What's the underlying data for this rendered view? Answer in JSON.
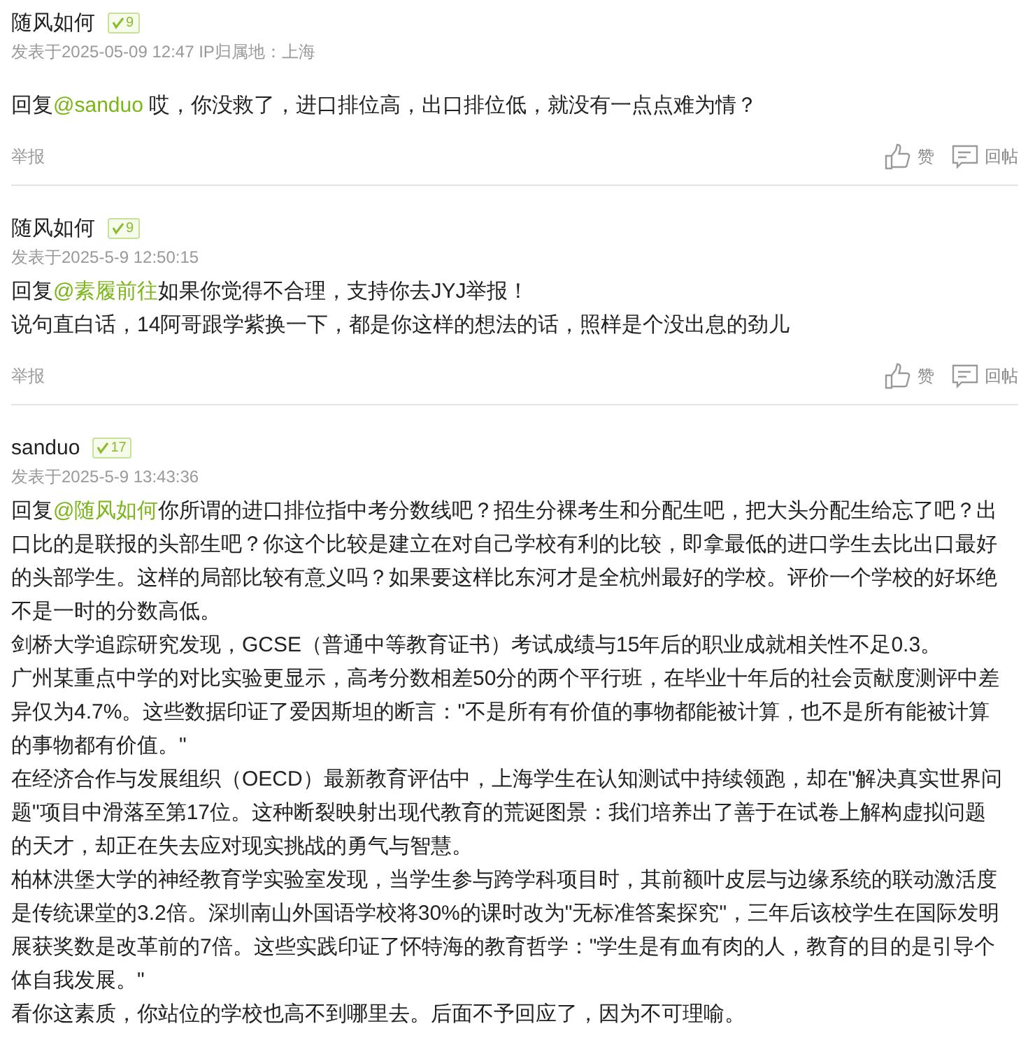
{
  "posts": [
    {
      "author": "随风如何",
      "level": "9",
      "date": "发表于2025-05-09 12:47 IP归属地：上海",
      "paragraphs": [
        [
          {
            "text": "回复"
          },
          {
            "text": "@sanduo",
            "kind": "mention"
          },
          {
            "text": " 哎，你没救了，进口排位高，出口排位低，就没有一点点难为情？"
          }
        ]
      ],
      "report": "举报",
      "actions": [
        {
          "kind": "like",
          "label": "赞"
        },
        {
          "kind": "reply",
          "label": "回帖"
        }
      ]
    },
    {
      "author": "随风如何",
      "level": "9",
      "date": "发表于2025-5-9 12:50:15",
      "paragraphs": [
        [
          {
            "text": "回复"
          },
          {
            "text": "@素履前往",
            "kind": "mention"
          },
          {
            "text": "如果你觉得不合理，支持你去JYJ举报！"
          }
        ],
        [
          {
            "text": "说句直白话，14阿哥跟学紫换一下，都是你这样的想法的话，照样是个没出息的劲儿"
          }
        ]
      ],
      "report": "举报",
      "actions": [
        {
          "kind": "like",
          "label": "赞"
        },
        {
          "kind": "reply",
          "label": "回帖"
        }
      ]
    },
    {
      "author": "sanduo",
      "level": "17",
      "date": "发表于2025-5-9 13:43:36",
      "paragraphs": [
        [
          {
            "text": "回复"
          },
          {
            "text": "@随风如何",
            "kind": "mention"
          },
          {
            "text": "你所谓的进口排位指中考分数线吧？招生分裸考生和分配生吧，把大头分配生给忘了吧？出口比的是联报的头部生吧？你这个比较是建立在对自己学校有利的比较，即拿最低的进口学生去比出口最好的头部学生。这样的局部比较有意义吗？如果要这样比东河才是全杭州最好的学校。评价一个学校的好坏绝不是一时的分数高低。"
          }
        ],
        [
          {
            "text": "剑桥大学追踪研究发现，GCSE（普通中等教育证书）考试成绩与15年后的职业成就相关性不足0.3。"
          }
        ],
        [
          {
            "text": "广州某重点中学的对比实验更显示，高考分数相差50分的两个平行班，在毕业十年后的社会贡献度测评中差异仅为4.7%。这些数据印证了爱因斯坦的断言：\"不是所有有价值的事物都能被计算，也不是所有能被计算的事物都有价值。\""
          }
        ],
        [
          {
            "text": "在经济合作与发展组织（OECD）最新教育评估中，上海学生在认知测试中持续领跑，却在\"解决真实世界问题\"项目中滑落至第17位。这种断裂映射出现代教育的荒诞图景：我们培养出了善于在试卷上解构虚拟问题的天才，却正在失去应对现实挑战的勇气与智慧。"
          }
        ],
        [
          {
            "text": "柏林洪堡大学的神经教育学实验室发现，当学生参与跨学科项目时，其前额叶皮层与边缘系统的联动激活度是传统课堂的3.2倍。深圳南山外国语学校将30%的课时改为\"无标准答案探究\"，三年后该校学生在国际发明展获奖数是改革前的7倍。这些实践印证了怀特海的教育哲学：\"学生是有血有肉的人，教育的目的是引导个体自我发展。\""
          }
        ],
        [
          {
            "text": "看你这素质，你站位的学校也高不到哪里去。后面不予回应了，因为不可理喻。"
          }
        ]
      ]
    }
  ]
}
